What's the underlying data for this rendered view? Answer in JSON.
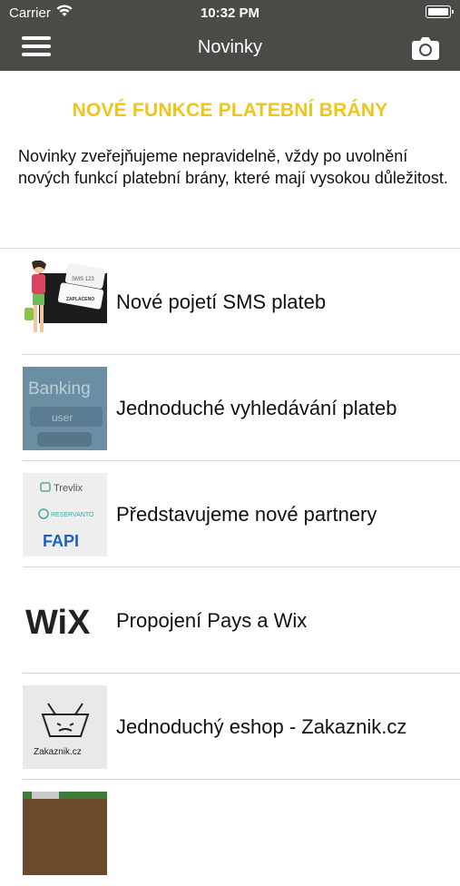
{
  "status": {
    "carrier": "Carrier",
    "time": "10:32 PM"
  },
  "nav": {
    "title": "Novinky",
    "menu_icon": "hamburger-menu-icon",
    "camera_icon": "camera-icon"
  },
  "headline": "NOVÉ FUNKCE PLATEBNÍ BRÁNY",
  "intro": "Novinky zveřejňujeme nepravidelně, vždy po uvolnění nových funkcí platební brány, které mají vysokou důležitost.",
  "items": [
    {
      "title": "Nové pojetí SMS plateb"
    },
    {
      "title": "Jednoduché vyhledávání plateb"
    },
    {
      "title": "Představujeme nové partnery"
    },
    {
      "title": "Propojení Pays a Wix"
    },
    {
      "title": "Jednoduchý eshop - Zakaznik.cz"
    }
  ],
  "thumbs": {
    "banking_text": "Banking",
    "banking_user": "user",
    "trevlix": "Trevlix",
    "reservanto": "RESERVANTO",
    "fapi": "FAPI",
    "wix": "WiX",
    "zakaznik": "Zakaznik.cz",
    "sms_card_top": "SMS 123",
    "sms_card_bottom": "ZAPLACENO"
  },
  "colors": {
    "bar": "#4a4a47",
    "accent": "#f0c419"
  }
}
